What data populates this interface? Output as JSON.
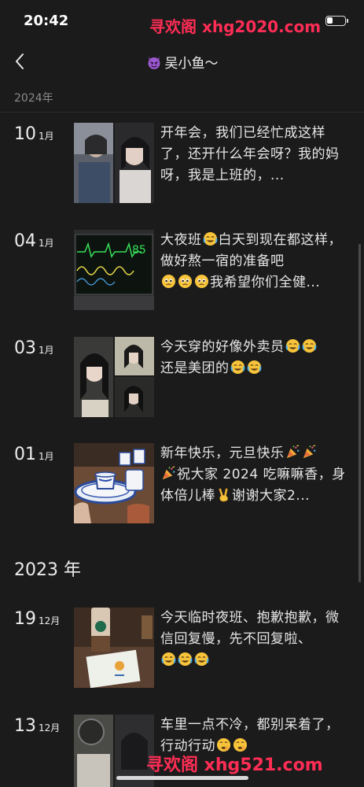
{
  "status_bar": {
    "time": "20:42",
    "watermark": "寻欢阁 xhg2020.com"
  },
  "nav": {
    "title": "吴小鱼～"
  },
  "sticky_year": "2024年",
  "entries_2024": [
    {
      "day": "10",
      "month": "1月",
      "text": "开年会，我们已经忙成这样了，还开什么年会呀？我的妈呀，我是上班的，..."
    },
    {
      "day": "04",
      "month": "1月",
      "text_parts": [
        "大夜班",
        "白天到现在都这样，做好熬一宿的准备吧",
        "我希望你们全健..."
      ],
      "monitor_value": "85"
    },
    {
      "day": "03",
      "month": "1月",
      "text_parts": [
        "今天穿的好像外卖员",
        "还是美团的"
      ]
    },
    {
      "day": "01",
      "month": "1月",
      "text_parts": [
        "新年快乐，元旦快乐",
        "祝大家 2024 吃嘛嘛香，身体倍儿棒",
        "谢谢大家2..."
      ]
    }
  ],
  "year_2023": "2023 年",
  "entries_2023": [
    {
      "day": "19",
      "month": "12月",
      "text": "今天临时夜班、抱歉抱歉，微信回复慢，先不回复啦、"
    },
    {
      "day": "13",
      "month": "12月",
      "text": "车里一点不冷，都别呆着了，行动行动"
    }
  ],
  "bottom_watermark": "寻欢阁 xhg521.com",
  "colors": {
    "background": "#1b1b1b",
    "text": "#e6e6e6",
    "muted": "#8a8a8a",
    "watermark": "#ff2d55"
  },
  "icons": {
    "back": "chevron-left-icon",
    "title_emoji": "devil-face-icon",
    "crying_laughing": "crying-laughing-icon",
    "party_popper": "party-popper-icon",
    "victory_hand": "victory-hand-icon",
    "pleading": "pleading-face-icon",
    "shushing": "shushing-face-icon"
  }
}
